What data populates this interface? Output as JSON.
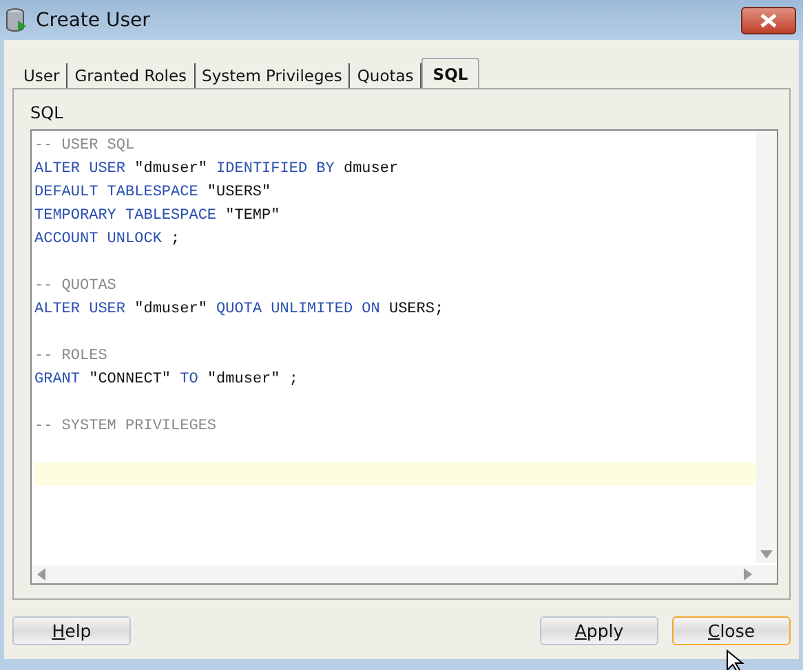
{
  "window": {
    "title": "Create User"
  },
  "tabs": [
    {
      "label": "User",
      "selected": false
    },
    {
      "label": "Granted Roles",
      "selected": false
    },
    {
      "label": "System Privileges",
      "selected": false
    },
    {
      "label": "Quotas",
      "selected": false
    },
    {
      "label": "SQL",
      "selected": true
    }
  ],
  "editor": {
    "label": "SQL",
    "lines": [
      {
        "kind": "code",
        "tokens": [
          {
            "kind": "comment",
            "text": "-- USER SQL"
          }
        ]
      },
      {
        "kind": "code",
        "tokens": [
          {
            "kind": "keyword",
            "text": "ALTER USER "
          },
          {
            "kind": "plain",
            "text": "\"dmuser\" "
          },
          {
            "kind": "keyword",
            "text": "IDENTIFIED BY "
          },
          {
            "kind": "plain",
            "text": "dmuser"
          }
        ]
      },
      {
        "kind": "code",
        "tokens": [
          {
            "kind": "keyword",
            "text": "DEFAULT TABLESPACE "
          },
          {
            "kind": "plain",
            "text": "\"USERS\""
          }
        ]
      },
      {
        "kind": "code",
        "tokens": [
          {
            "kind": "keyword",
            "text": "TEMPORARY TABLESPACE "
          },
          {
            "kind": "plain",
            "text": "\"TEMP\""
          }
        ]
      },
      {
        "kind": "code",
        "tokens": [
          {
            "kind": "keyword",
            "text": "ACCOUNT UNLOCK "
          },
          {
            "kind": "plain",
            "text": ";"
          }
        ]
      },
      {
        "kind": "blank"
      },
      {
        "kind": "code",
        "tokens": [
          {
            "kind": "comment",
            "text": "-- QUOTAS"
          }
        ]
      },
      {
        "kind": "code",
        "tokens": [
          {
            "kind": "keyword",
            "text": "ALTER USER "
          },
          {
            "kind": "plain",
            "text": "\"dmuser\" "
          },
          {
            "kind": "keyword",
            "text": "QUOTA UNLIMITED ON "
          },
          {
            "kind": "plain",
            "text": "USERS;"
          }
        ]
      },
      {
        "kind": "blank"
      },
      {
        "kind": "code",
        "tokens": [
          {
            "kind": "comment",
            "text": "-- ROLES"
          }
        ]
      },
      {
        "kind": "code",
        "tokens": [
          {
            "kind": "keyword",
            "text": "GRANT "
          },
          {
            "kind": "plain",
            "text": "\"CONNECT\" "
          },
          {
            "kind": "keyword",
            "text": "TO "
          },
          {
            "kind": "plain",
            "text": "\"dmuser\" ;"
          }
        ]
      },
      {
        "kind": "blank"
      },
      {
        "kind": "code",
        "tokens": [
          {
            "kind": "comment",
            "text": "-- SYSTEM PRIVILEGES"
          }
        ]
      },
      {
        "kind": "blank"
      },
      {
        "kind": "current_blank"
      }
    ]
  },
  "left_buttons": [
    {
      "label": "Help",
      "focused": false,
      "mnemonic_underlined": true
    }
  ],
  "right_buttons": [
    {
      "label": "Apply",
      "focused": false,
      "mnemonic_underlined": true
    },
    {
      "label": "Close",
      "focused": true,
      "mnemonic_underlined": true
    }
  ]
}
